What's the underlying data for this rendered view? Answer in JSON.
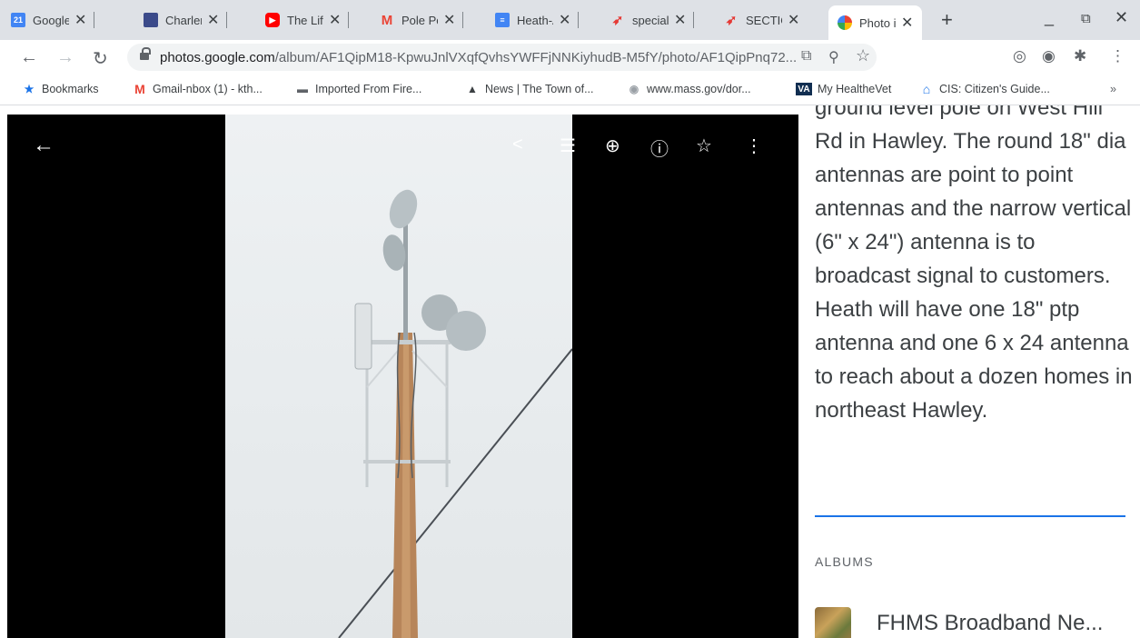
{
  "tabs": [
    {
      "title": "Google C",
      "favicon": "calendar-icon",
      "favicon_text": "21",
      "color": "#4285f4"
    },
    {
      "title": "Charlem",
      "favicon": "charlemont-icon",
      "favicon_text": "",
      "color": "#3b4a8a"
    },
    {
      "title": "The Life",
      "favicon": "youtube-icon",
      "favicon_text": "",
      "color": "#ff0000"
    },
    {
      "title": "Pole Pe",
      "favicon": "gmail-icon",
      "favicon_text": "M",
      "color": "#ea4335"
    },
    {
      "title": "Heath-A",
      "favicon": "docs-icon",
      "favicon_text": "",
      "color": "#4285f4"
    },
    {
      "title": "special-",
      "favicon": "rocket-icon",
      "favicon_text": "",
      "color": "#e53935"
    },
    {
      "title": "SECTIO",
      "favicon": "rocket-icon",
      "favicon_text": "",
      "color": "#e53935"
    },
    {
      "title": "Photo in",
      "favicon": "google-photos-icon",
      "favicon_text": "",
      "color": "#fbbc04"
    }
  ],
  "address": {
    "domain": "photos.google.com",
    "path": "/album/AF1QipM18-KpwuJnlVXqfQvhsYWFFjNNKiyhudB-M5fY/photo/AF1QipPnq72..."
  },
  "bookmarks": [
    {
      "label": "Bookmarks",
      "icon": "star-icon",
      "glyph": "★",
      "color": "#1a73e8"
    },
    {
      "label": "Gmail-nbox (1) - kth...",
      "icon": "gmail-icon",
      "glyph": "M",
      "color": "#ea4335"
    },
    {
      "label": "Imported From Fire...",
      "icon": "folder-icon",
      "glyph": "▬",
      "color": "#5f6368"
    },
    {
      "label": "News | The Town of...",
      "icon": "town-icon",
      "glyph": "▲",
      "color": "#3c4043"
    },
    {
      "label": "www.mass.gov/dor...",
      "icon": "seal-icon",
      "glyph": "◉",
      "color": "#9aa0a6"
    },
    {
      "label": "My HealtheVet",
      "icon": "va-icon",
      "glyph": "VA",
      "color": "#112e51"
    },
    {
      "label": "CIS: Citizen's Guide...",
      "icon": "building-icon",
      "glyph": "⌂",
      "color": "#1a73e8"
    }
  ],
  "bookmarks_overflow": "»",
  "description": "ground level pole on West Hill Rd in Hawley. The round 18\" dia antennas are point to point antennas and the narrow vertical (6\" x 24\") antenna is to broadcast signal to customers. Heath will have one 18\" ptp antenna and one 6 x 24 antenna to reach about a dozen homes in northeast Hawley.",
  "albums_label": "ALBUMS",
  "album": {
    "name": "FHMS Broadband Ne..."
  }
}
